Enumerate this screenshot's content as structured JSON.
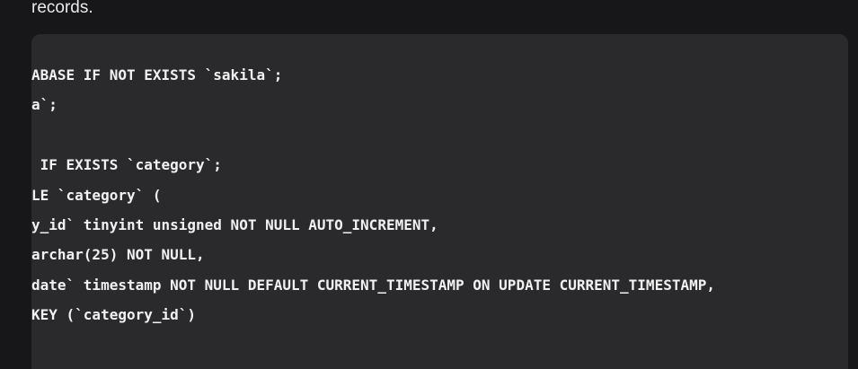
{
  "intro": {
    "text": "records."
  },
  "code": {
    "lines": [
      "ABASE IF NOT EXISTS `sakila`;",
      "a`;",
      "",
      " IF EXISTS `category`;",
      "LE `category` (",
      "y_id` tinyint unsigned NOT NULL AUTO_INCREMENT,",
      "archar(25) NOT NULL,",
      "date` timestamp NOT NULL DEFAULT CURRENT_TIMESTAMP ON UPDATE CURRENT_TIMESTAMP,",
      "KEY (`category_id`)"
    ]
  }
}
